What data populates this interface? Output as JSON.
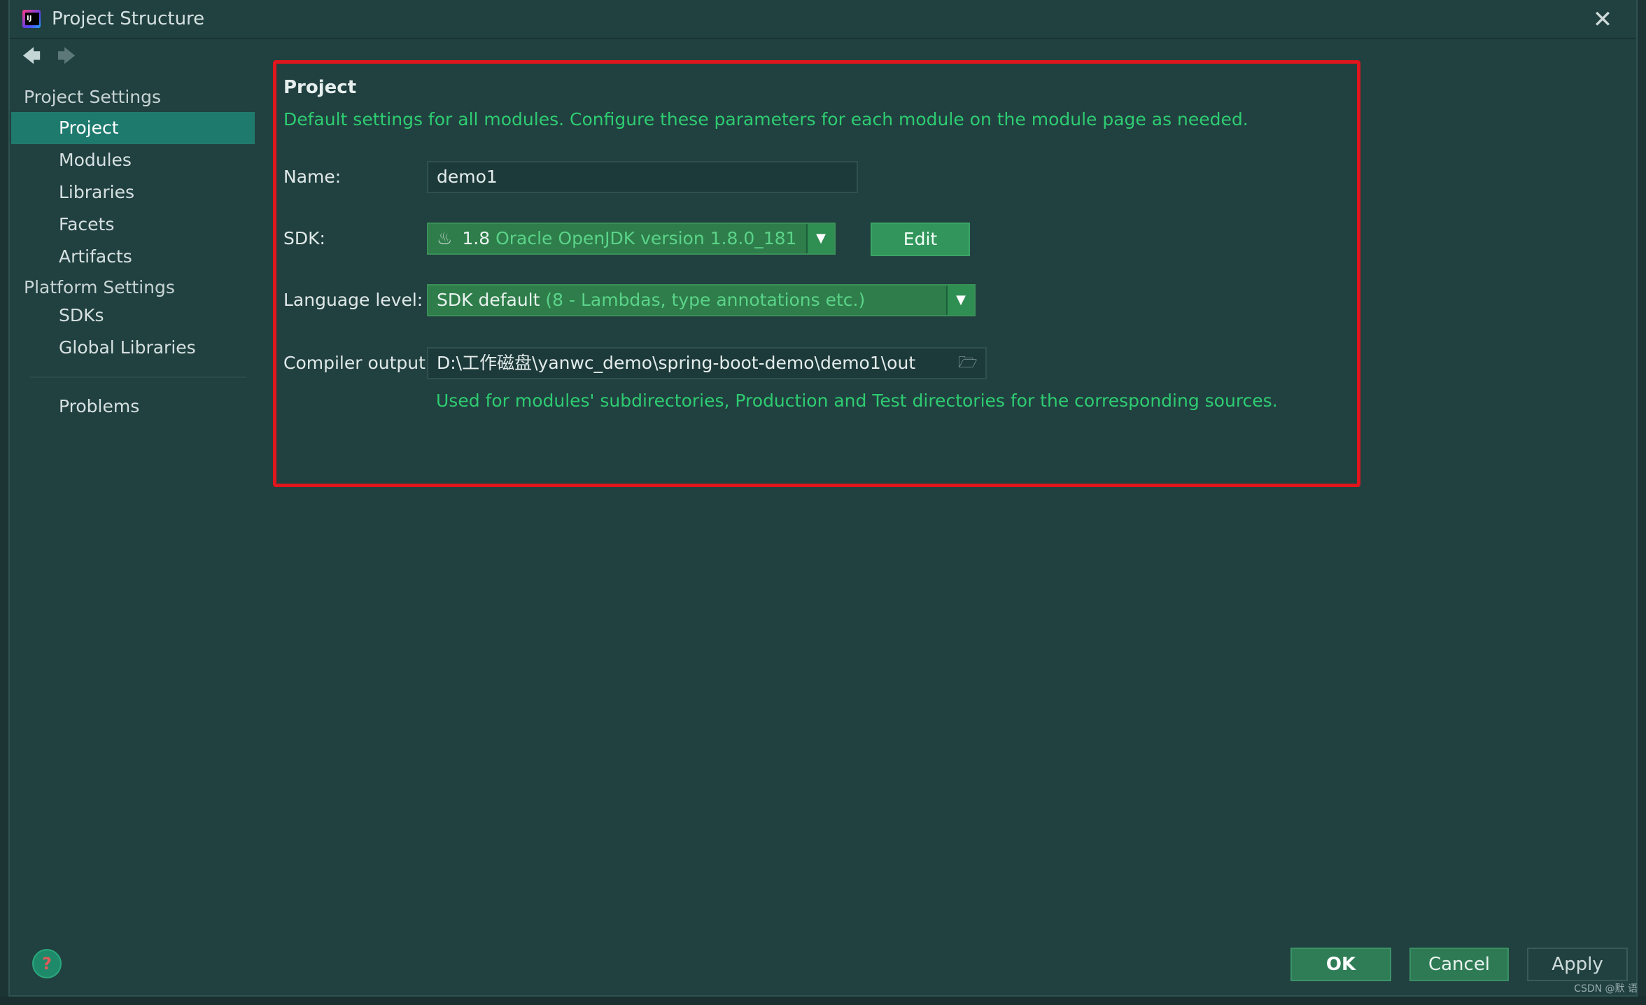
{
  "window": {
    "title": "Project Structure",
    "close_glyph": "✕"
  },
  "nav": {
    "back_glyph": "🡄",
    "forward_glyph": "🡆"
  },
  "sidebar": {
    "group_project_settings": "Project Settings",
    "items_project": [
      "Project",
      "Modules",
      "Libraries",
      "Facets",
      "Artifacts"
    ],
    "group_platform_settings": "Platform Settings",
    "items_platform": [
      "SDKs",
      "Global Libraries"
    ],
    "problems": "Problems",
    "selected": "Project"
  },
  "content": {
    "section_title": "Project",
    "description": "Default settings for all modules. Configure these parameters for each module on the module page as needed.",
    "name_label": "Name:",
    "name_value": "demo1",
    "sdk_label": "SDK:",
    "sdk_version": "1.8",
    "sdk_detail": "Oracle OpenJDK version 1.8.0_181",
    "edit_button": "Edit",
    "language_label": "Language level:",
    "language_value": "SDK default",
    "language_detail": "(8 - Lambdas, type annotations etc.)",
    "compiler_label": "Compiler output:",
    "compiler_value": "D:\\工作磁盘\\yanwc_demo\\spring-boot-demo\\demo1\\out",
    "compiler_hint": "Used for modules' subdirectories, Production and Test directories for the corresponding sources."
  },
  "footer": {
    "ok": "OK",
    "cancel": "Cancel",
    "apply": "Apply",
    "help_glyph": "?",
    "watermark": "CSDN @默  语"
  },
  "colors": {
    "background": "#214040",
    "accent_green": "#2ecc71",
    "selection": "#1f7a6e",
    "highlight_border": "#e0161c"
  }
}
